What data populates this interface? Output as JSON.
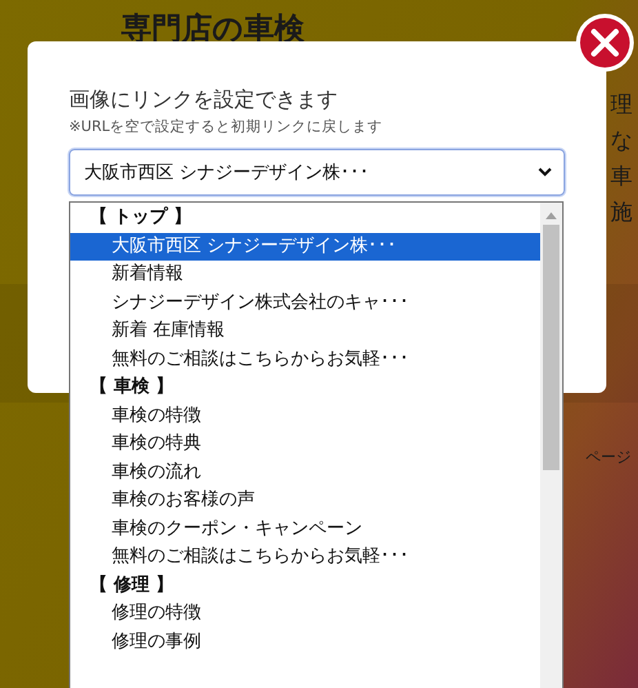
{
  "background": {
    "heading": "専門店の車検",
    "side_texts": [
      "理",
      "な",
      "車",
      "施"
    ],
    "page_link": "ページ"
  },
  "dialog": {
    "title": "画像にリンクを設定できます",
    "note": "※URLを空で設定すると初期リンクに戻します",
    "select": {
      "value": "大阪市西区 シナジーデザイン株･･･"
    },
    "groups": [
      {
        "label": "【 トップ 】",
        "options": [
          {
            "label": "大阪市西区 シナジーデザイン株･･･",
            "selected": true
          },
          {
            "label": "新着情報",
            "selected": false
          },
          {
            "label": "シナジーデザイン株式会社のキャ･･･",
            "selected": false
          },
          {
            "label": "新着 在庫情報",
            "selected": false
          },
          {
            "label": "無料のご相談はこちらからお気軽･･･",
            "selected": false
          }
        ]
      },
      {
        "label": "【 車検 】",
        "options": [
          {
            "label": "車検の特徴",
            "selected": false
          },
          {
            "label": "車検の特典",
            "selected": false
          },
          {
            "label": "車検の流れ",
            "selected": false
          },
          {
            "label": "車検のお客様の声",
            "selected": false
          },
          {
            "label": "車検のクーポン・キャンペーン",
            "selected": false
          },
          {
            "label": "無料のご相談はこちらからお気軽･･･",
            "selected": false
          }
        ]
      },
      {
        "label": "【 修理 】",
        "options": [
          {
            "label": "修理の特徴",
            "selected": false
          },
          {
            "label": "修理の事例",
            "selected": false
          }
        ]
      }
    ]
  }
}
